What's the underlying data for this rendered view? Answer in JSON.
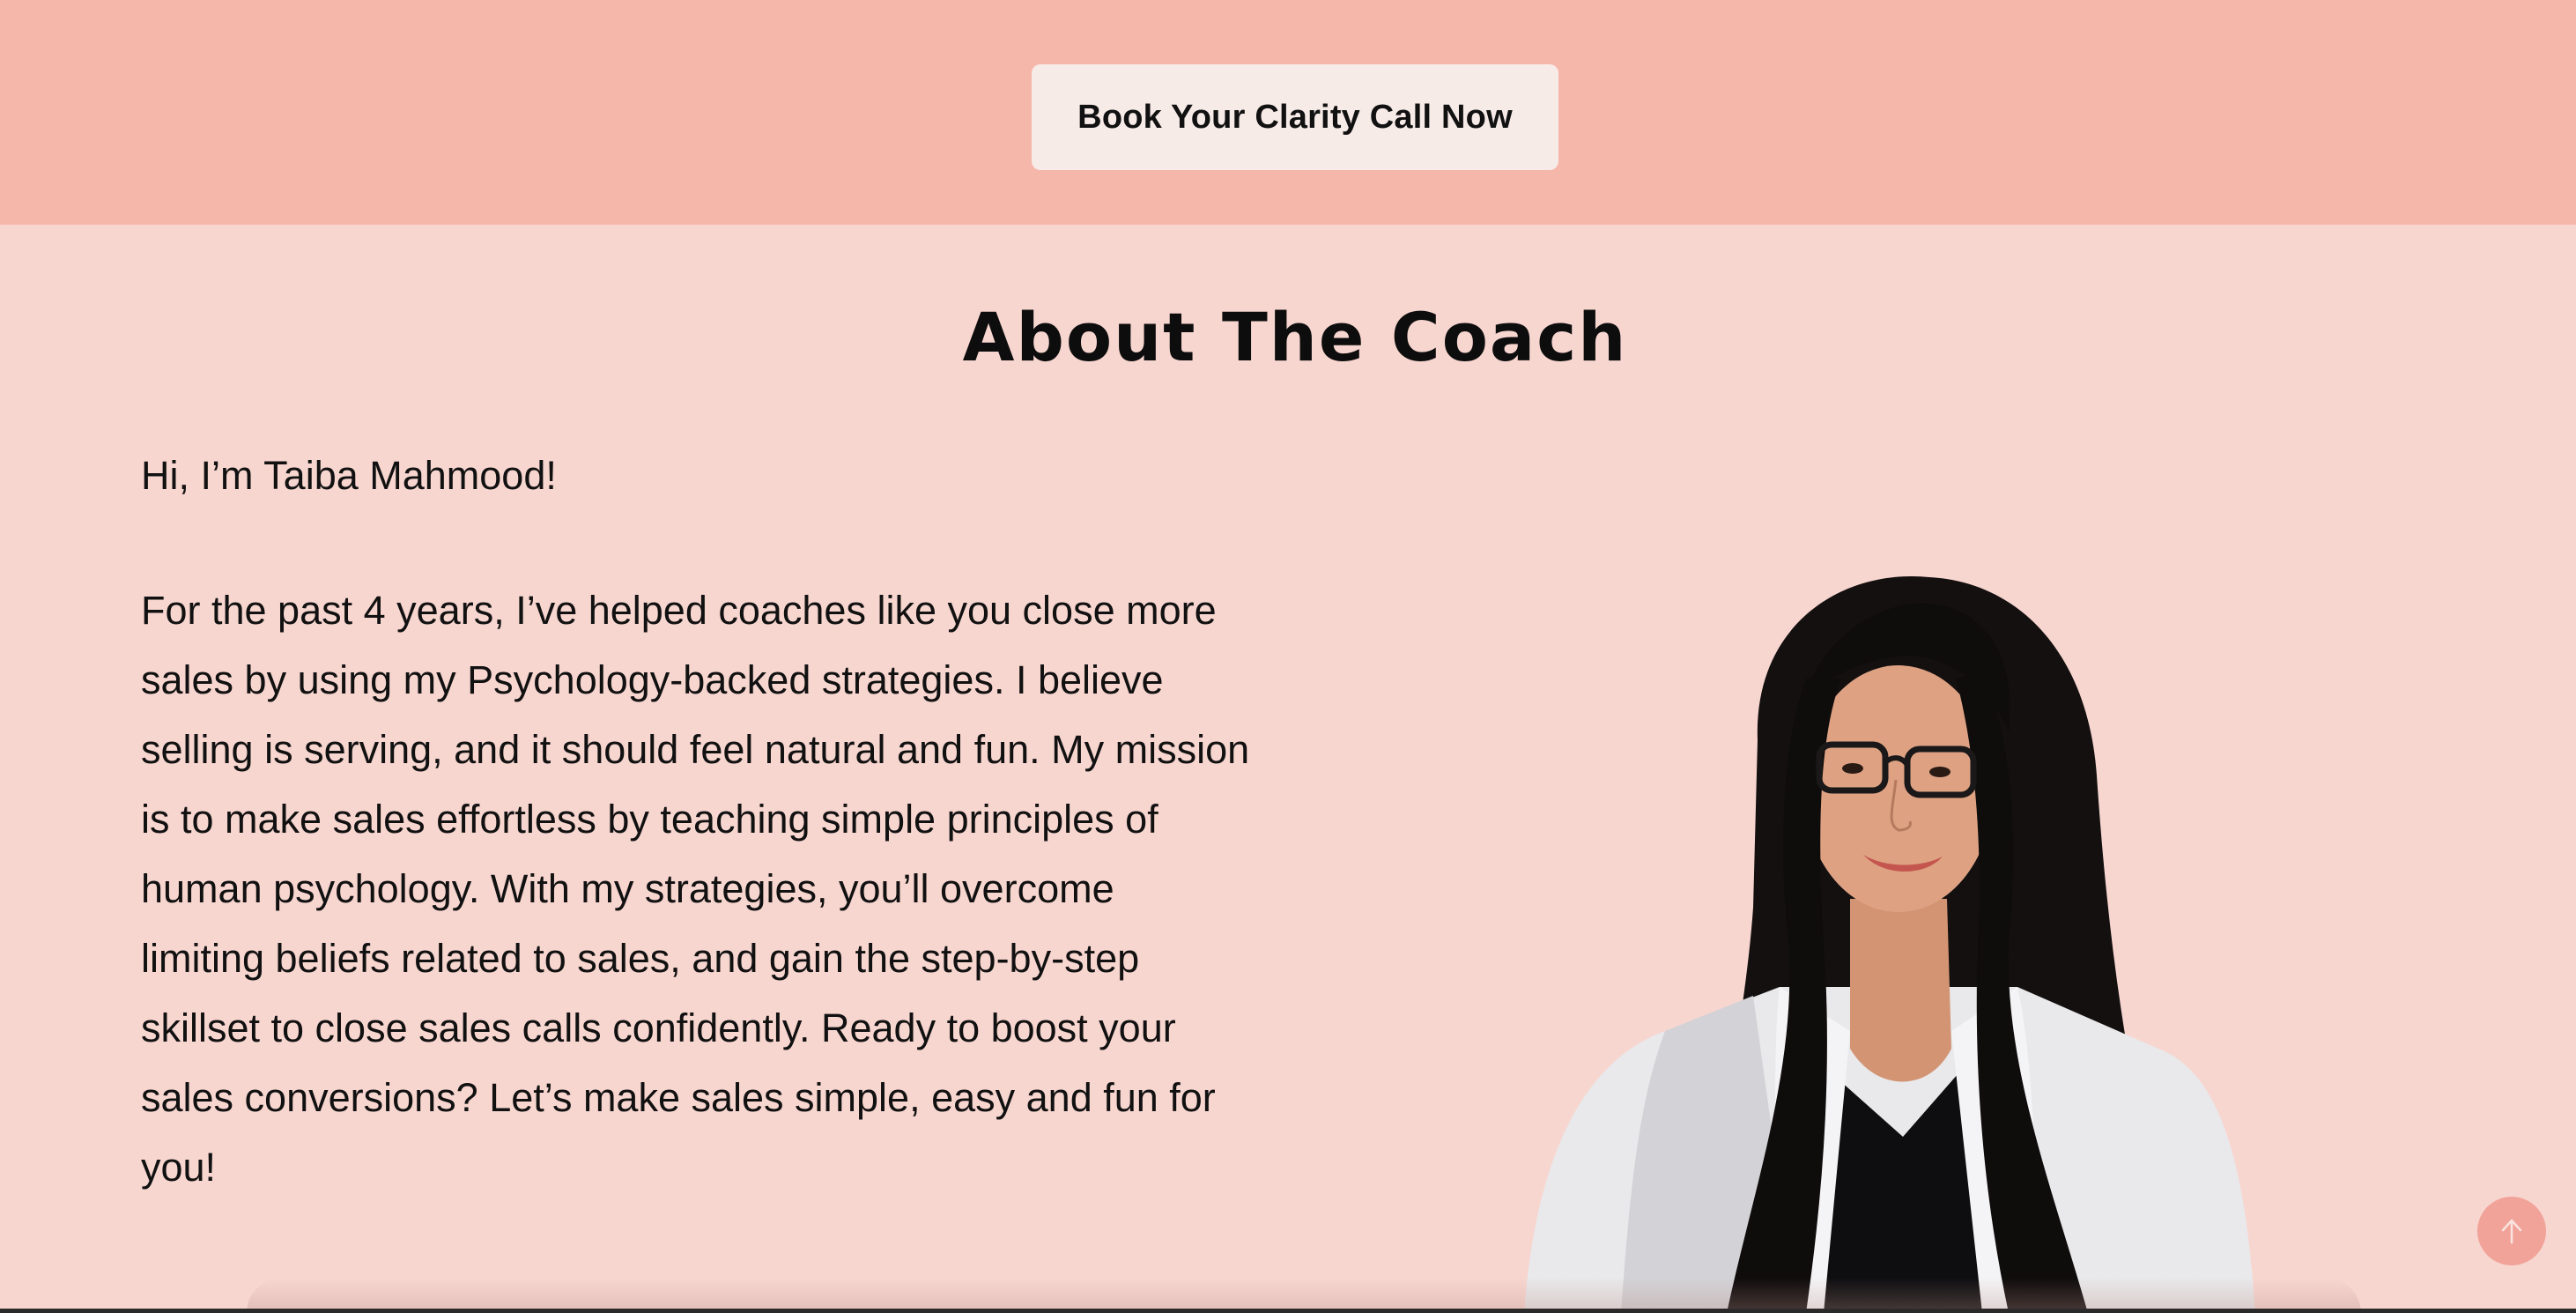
{
  "top_banner": {
    "cta_label": "Book Your Clarity Call Now"
  },
  "about": {
    "title": "About The Coach",
    "greeting": "Hi, I’m Taiba Mahmood!",
    "bio_lines": [
      "For the past 4 years, I’ve helped coaches like you close more",
      "sales by using my Psychology-backed strategies. I believe",
      "selling is serving, and it should feel natural and fun. My mission",
      "is to make sales effortless by teaching simple principles of",
      "human psychology. With my strategies, you’ll overcome",
      "limiting beliefs related to sales, and gain the step-by-step",
      "skillset to close sales calls confidently.  Ready to boost your",
      "sales conversions? Let’s make sales simple, easy and fun for",
      "you!"
    ],
    "portrait_icon": "coach-portrait-photo"
  },
  "scroll_top": {
    "icon": "arrow-up-icon"
  },
  "colors": {
    "banner_bg": "#f6b7ab",
    "section_bg": "#f8d6d0",
    "button_bg": "#f7ebe8",
    "scroll_top_bg": "#f1a399",
    "text": "#111111"
  }
}
